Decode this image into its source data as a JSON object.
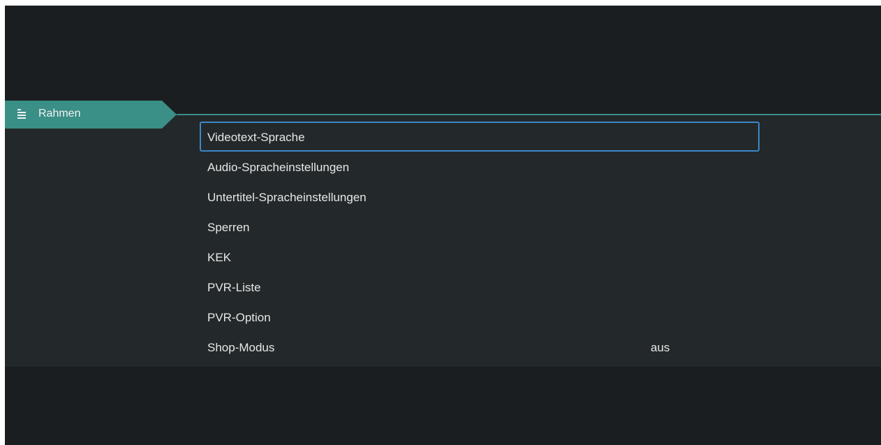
{
  "header": {
    "tab_label": "Rahmen",
    "tab_icon": "list-icon"
  },
  "menu": {
    "items": [
      {
        "label": "Videotext-Sprache",
        "value": "",
        "focused": true
      },
      {
        "label": "Audio-Spracheinstellungen",
        "value": ""
      },
      {
        "label": "Untertitel-Spracheinstellungen",
        "value": ""
      },
      {
        "label": "Sperren",
        "value": ""
      },
      {
        "label": "KEK",
        "value": ""
      },
      {
        "label": "PVR-Liste",
        "value": ""
      },
      {
        "label": "PVR-Option",
        "value": ""
      },
      {
        "label": "Shop-Modus",
        "value": "aus"
      }
    ]
  },
  "colors": {
    "background": "#1b1e20",
    "menu_band": "#23282a",
    "accent_teal": "#3a8f87",
    "focus_border": "#3c88c6",
    "text": "#e7e7e7"
  }
}
